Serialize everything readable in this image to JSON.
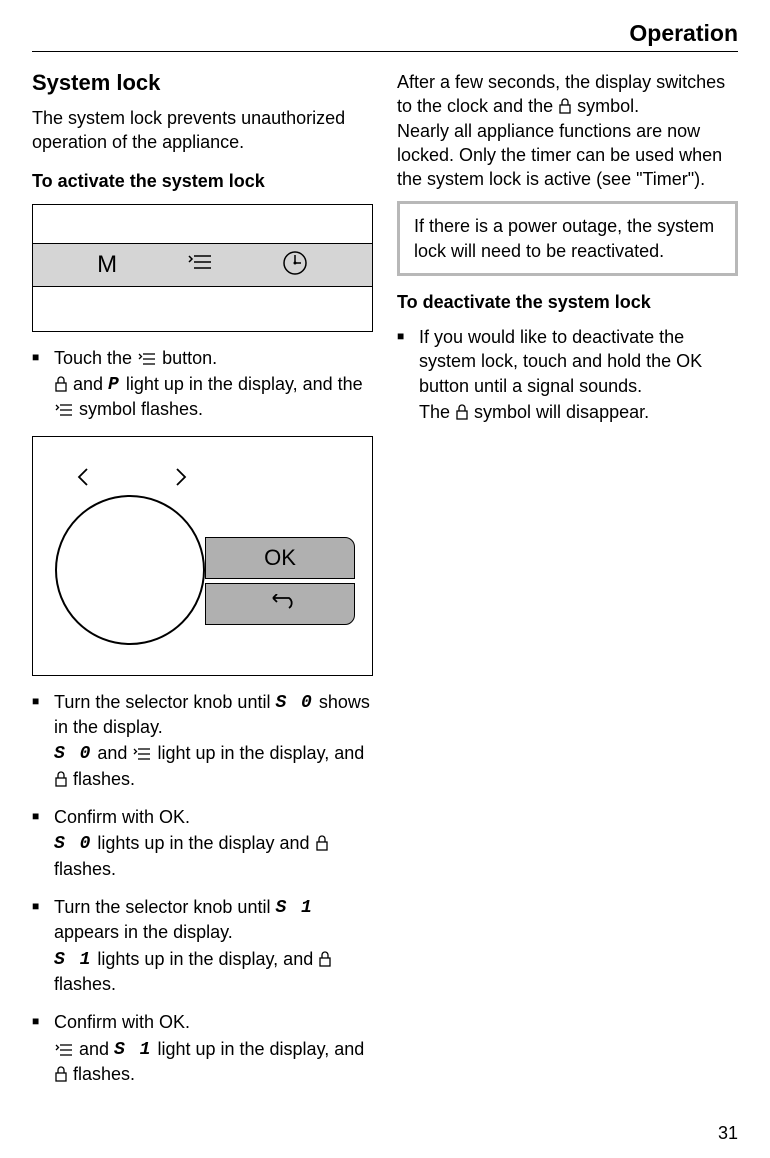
{
  "header": {
    "section": "Operation"
  },
  "left": {
    "h2": "System lock",
    "intro": "The system lock prevents unauthorized operation of the appliance.",
    "h3_activate": "To activate the system lock",
    "display": {
      "m": "M"
    },
    "step1_a": "Touch the ",
    "step1_b": " button.",
    "step1_sub_a": " and ",
    "step1_sub_b": " light up in the display, and the ",
    "step1_sub_c": " symbol flashes.",
    "p_char": "P",
    "ok": "OK",
    "step2_a": "Turn the selector knob until ",
    "step2_b": " shows in the display.",
    "step2_sub_a": " and ",
    "step2_sub_b": " light up in the display, and ",
    "step2_sub_c": " flashes.",
    "s0": "S 0",
    "step3_a": "Confirm with OK.",
    "step3_sub_a": " lights up in the display and ",
    "step3_sub_b": " flashes.",
    "step4_a": "Turn the selector knob until ",
    "step4_b": " appears in the display.",
    "step4_sub_a": " lights up in the display, and ",
    "step4_sub_b": " flashes.",
    "s1": "S 1",
    "step5_a": "Confirm with OK.",
    "step5_sub_a": " and ",
    "step5_sub_b": " light up in the display, and ",
    "step5_sub_c": " flashes."
  },
  "right": {
    "p1_a": "After a few seconds, the display switches to the clock and the ",
    "p1_b": " symbol.",
    "p2": "Nearly all appliance functions are now locked. Only the timer can be used when the system lock is active (see \"Timer\").",
    "note": "If there is a power outage, the system lock will need to be reactivated.",
    "h3_deactivate": "To deactivate the system lock",
    "step1_a": "If you would like to deactivate the system lock, touch and hold the OK button until a signal sounds.",
    "step1_sub_a": "The ",
    "step1_sub_b": " symbol will disappear."
  },
  "page_number": "31"
}
